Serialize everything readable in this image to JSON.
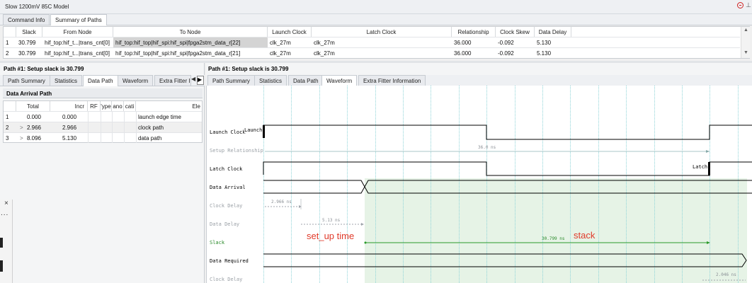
{
  "window": {
    "title": "Slow 1200mV 85C Model"
  },
  "main_tabs": [
    {
      "label": "Command Info"
    },
    {
      "label": "Summary of Paths"
    }
  ],
  "paths_table": {
    "columns": [
      "Slack",
      "From Node",
      "To Node",
      "Launch Clock",
      "Latch Clock",
      "Relationship",
      "Clock Skew",
      "Data Delay"
    ],
    "rows": [
      {
        "index": "1",
        "slack": "30.799",
        "from": "hif_top:hif_t...|trans_cnt[0]",
        "to": "hif_top:hif_top|hif_spi:hif_spi|fpga2stm_data_r[22]",
        "launch": "clk_27m",
        "latch": "clk_27m",
        "relationship": "36.000",
        "skew": "-0.092",
        "delay": "5.130"
      },
      {
        "index": "2",
        "slack": "30.799",
        "from": "hif_top:hif_t...|trans_cnt[0]",
        "to": "hif_top:hif_top|hif_spi:hif_spi|fpga2stm_data_r[21]",
        "launch": "clk_27m",
        "latch": "clk_27m",
        "relationship": "36.000",
        "skew": "-0.092",
        "delay": "5.130"
      }
    ]
  },
  "left_panel": {
    "title": "Path #1: Setup slack is 30.799",
    "tabs": [
      "Path Summary",
      "Statistics",
      "Data Path",
      "Waveform",
      "Extra Fitter I"
    ],
    "section_title": "Data Arrival Path",
    "columns": [
      "Total",
      "Incr",
      "RF",
      "Type",
      "Fanout",
      "Location",
      "Ele"
    ],
    "columns_display": [
      "Total",
      "Incr",
      "RF",
      "'ype",
      "ano",
      "cati",
      "Ele"
    ],
    "rows": [
      {
        "index": "1",
        "expand": "",
        "total": "0.000",
        "incr": "0.000",
        "element": "launch edge time"
      },
      {
        "index": "2",
        "expand": ">",
        "total": "2.966",
        "incr": "2.966",
        "element": "clock path"
      },
      {
        "index": "3",
        "expand": ">",
        "total": "8.096",
        "incr": "5.130",
        "element": "data path"
      }
    ],
    "popup_close": "×",
    "popup_more": "..."
  },
  "right_panel": {
    "title": "Path #1: Setup slack is 30.799",
    "tabs": [
      "Path Summary",
      "Statistics",
      "Data Path",
      "Waveform",
      "Extra Fitter Information"
    ]
  },
  "waveform": {
    "signals": [
      "Launch Clock",
      "Setup Relationship",
      "Latch Clock",
      "Data Arrival",
      "Clock Delay",
      "Data Delay",
      "Slack",
      "Data Required",
      "Clock Delay"
    ],
    "labels": {
      "launch_tag": "Launch",
      "latch_tag": "Latch",
      "setup_relationship": "36.0 ns",
      "clock_delay": "2.966 ns",
      "data_delay": "5.13 ns",
      "slack_value": "30.799 ns",
      "clock_delay_2": "2.046 ns"
    },
    "annotations": {
      "setup_time": "set_up time",
      "slack": "stack"
    },
    "colors": {
      "grid": "#8fd4d8",
      "required_fill": "#e6f3e6",
      "slack": "#2a9a2a",
      "annotation": "#e03a2a"
    }
  }
}
